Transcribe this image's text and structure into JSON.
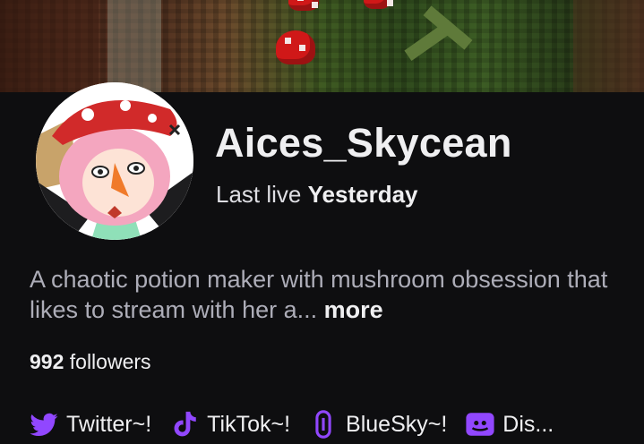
{
  "channel": {
    "name": "Aices_Skycean",
    "last_live_prefix": "Last live",
    "last_live_value": "Yesterday",
    "bio": "A chaotic potion maker with mushroom obsession that likes to stream with her a...",
    "bio_more": "more",
    "followers_count": "992",
    "followers_label": "followers"
  },
  "socials": [
    {
      "label": "Twitter~!",
      "icon": "twitter-bird-icon"
    },
    {
      "label": "TikTok~!",
      "icon": "tiktok-icon"
    },
    {
      "label": "BlueSky~!",
      "icon": "link-icon"
    },
    {
      "label": "Dis...",
      "icon": "discord-icon"
    }
  ],
  "colors": {
    "background": "#0e0e10",
    "accent": "#9147ff",
    "text_primary": "#efeff1",
    "text_muted": "#adadb8"
  }
}
